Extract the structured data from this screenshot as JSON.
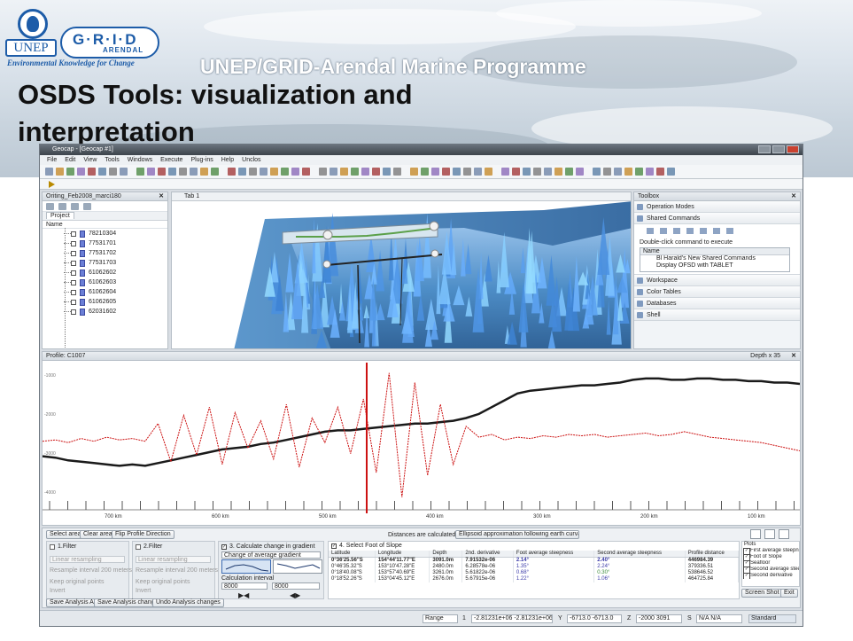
{
  "slide": {
    "logo_unep": "UNEP",
    "logo_grid": "G·R·I·D",
    "logo_arendal": "ARENDAL",
    "logo_tagline": "Environmental Knowledge for Change",
    "programme": "UNEP/GRID-Arendal Marine Programme",
    "title_line1": "OSDS Tools: visualization and",
    "title_line2": "interpretation"
  },
  "app": {
    "window_title": "Geocap - [Geocap #1]",
    "menu": [
      "File",
      "Edit",
      "View",
      "Tools",
      "Windows",
      "Execute",
      "Plug-ins",
      "Help",
      "Unclos"
    ]
  },
  "project_pane": {
    "title": "Oriting_Feb2008_marci180",
    "tab": "Project",
    "column": "Name",
    "items": [
      "78210304",
      "77531701",
      "77531702",
      "77531703",
      "61062602",
      "61062603",
      "61062604",
      "61062605",
      "62031602"
    ]
  },
  "view3d": {
    "tab": "Tab 1"
  },
  "toolbox": {
    "title": "Toolbox",
    "operation_modes": "Operation Modes",
    "shared_commands": "Shared Commands",
    "hint": "Double-click command to execute",
    "list_header": "Name",
    "list_rows": [
      "Bl Harald's New Shared Commands",
      "Display OFSD with TABLET"
    ],
    "workspace": "Workspace",
    "color_tables": "Color Tables",
    "databases": "Databases",
    "shell": "Shell"
  },
  "profile": {
    "title": "Profile: C1007",
    "depth_label": "Depth x 35"
  },
  "chart_data": {
    "type": "line",
    "x_tick_labels": [
      "700 km",
      "600 km",
      "500 km",
      "400 km",
      "300 km",
      "200 km",
      "100 km"
    ],
    "y_tick_labels": [
      "-1000",
      "-2000",
      "-3000",
      "-4000"
    ],
    "series": [
      {
        "color": "#1a1a1a",
        "values": [
          0.34,
          0.33,
          0.31,
          0.3,
          0.29,
          0.28,
          0.27,
          0.28,
          0.27,
          0.29,
          0.31,
          0.33,
          0.35,
          0.37,
          0.39,
          0.4,
          0.41,
          0.43,
          0.44,
          0.46,
          0.48,
          0.5,
          0.52,
          0.53,
          0.53,
          0.54,
          0.55,
          0.56,
          0.57,
          0.58,
          0.58,
          0.59,
          0.6,
          0.62,
          0.65,
          0.7,
          0.75,
          0.8,
          0.82,
          0.83,
          0.84,
          0.85,
          0.86,
          0.86,
          0.87,
          0.88,
          0.9,
          0.91,
          0.91,
          0.9,
          0.9,
          0.91,
          0.91,
          0.9,
          0.9,
          0.89,
          0.89,
          0.88,
          0.88,
          0.87
        ]
      },
      {
        "color": "#cc1111",
        "values": [
          0.45,
          0.46,
          0.44,
          0.47,
          0.45,
          0.48,
          0.46,
          0.47,
          0.45,
          0.58,
          0.3,
          0.64,
          0.35,
          0.7,
          0.28,
          0.66,
          0.4,
          0.6,
          0.32,
          0.72,
          0.26,
          0.62,
          0.44,
          0.7,
          0.36,
          0.76,
          0.22,
          0.95,
          0.04,
          0.88,
          0.2,
          0.72,
          0.28,
          0.56,
          0.48,
          0.5,
          0.46,
          0.48,
          0.47,
          0.49,
          0.48,
          0.5,
          0.49,
          0.5,
          0.48,
          0.49,
          0.5,
          0.51,
          0.49,
          0.5,
          0.52,
          0.5,
          0.48,
          0.47,
          0.46,
          0.45,
          0.44,
          0.42,
          0.4,
          0.38
        ]
      }
    ]
  },
  "analysis": {
    "buttons": [
      "Select area",
      "Clear area",
      "Flip Profile Direction"
    ],
    "distance_note": "Distances are calculated using",
    "distance_method": "Ellipsoid approximation following earth curvature",
    "filter1": {
      "label": "1.Filter",
      "method": "Linear resampling",
      "interval": "Resample interval 200",
      "unit": "meters",
      "keep": "Keep original points",
      "invert": "Invert"
    },
    "filter2": {
      "label": "2.Filter",
      "method": "Linear resampling",
      "interval": "Resample interval 200",
      "unit": "meters",
      "keep": "Keep original points",
      "invert": "Invert"
    },
    "gradient": {
      "label": "3. Calculate change in gradient",
      "mode": "Change of average gradient",
      "interval_label": "Calculation interval",
      "val1": "8000",
      "val2": "8000"
    },
    "slope": {
      "label": "4. Select Foot of Slope",
      "headers": [
        "Latitude",
        "Longitude",
        "Depth",
        "2nd. derivative",
        "Foot average steepness",
        "Second average steepness",
        "Profile distance"
      ],
      "rows": [
        [
          "0°36'25.56\"S",
          "154°44'11.77\"E",
          "3091.0m",
          "7.91532e-06",
          "2.14°",
          "2.40°",
          "446984.39"
        ],
        [
          "0°46'35.32\"S",
          "153°10'47.28\"E",
          "2480.0m",
          "6.28578e-06",
          "1.35°",
          "2.24°",
          "379336.51"
        ],
        [
          "0°18'40.08\"S",
          "153°57'40.69\"E",
          "3261.0m",
          "5.61822e-06",
          "0.68°",
          "0.30°",
          "538646.52"
        ],
        [
          "0°18'52.26\"S",
          "153°04'45.12\"E",
          "2676.0m",
          "5.67915e-06",
          "1.22°",
          "1.06°",
          "464725.84"
        ]
      ]
    },
    "plots": {
      "title": "Plots",
      "items": [
        "First average steepness",
        "Foot of Slope",
        "Seafloor",
        "Second average steepness",
        "Second derivative"
      ]
    },
    "bottom_buttons": [
      "Save Analysis As...",
      "Save Analysis changes",
      "Undo Analysis changes"
    ],
    "screen_shot": "Screen Shot",
    "exit": "Exit"
  },
  "statusbar": {
    "range_label": "Range",
    "range_index": "1",
    "x_range": "-2.81231e+06  -2.81231e+06",
    "y_label": "Y",
    "y_range": "-6713.0  -6713.0",
    "z_label": "Z",
    "z_range": "-2000  3091",
    "s_label": "S",
    "s_range": "N/A  N/A",
    "mode": "Standard"
  }
}
